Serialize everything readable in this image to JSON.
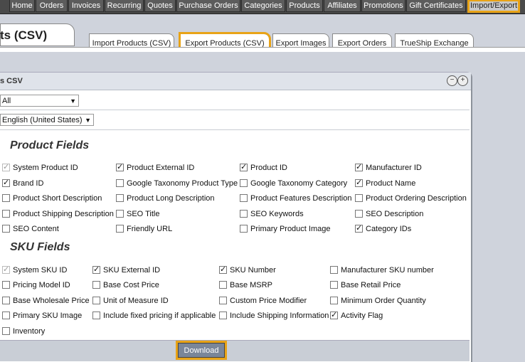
{
  "topnav": {
    "items": [
      "Home",
      "Orders",
      "Invoices",
      "Recurring",
      "Quotes",
      "Purchase Orders",
      "Categories",
      "Products",
      "Affiliates",
      "Promotions",
      "Gift Certificates",
      "Import/Export"
    ]
  },
  "page": {
    "title_fragment": "ts (CSV)"
  },
  "subtabs": [
    "Import Products (CSV)",
    "Export Products (CSV)",
    "Export Images",
    "Export Orders",
    "TrueShip Exchange"
  ],
  "panel": {
    "title_fragment": "s CSV",
    "select_scope": "All",
    "select_language": "English (United States)"
  },
  "product_fields": {
    "title": "Product Fields",
    "items": [
      {
        "label": "System Product ID",
        "checked": true,
        "disabled": true
      },
      {
        "label": "Product External ID",
        "checked": true,
        "disabled": false
      },
      {
        "label": "Product ID",
        "checked": true,
        "disabled": false
      },
      {
        "label": "Manufacturer ID",
        "checked": true,
        "disabled": false
      },
      {
        "label": "Brand ID",
        "checked": true,
        "disabled": false
      },
      {
        "label": "Google Taxonomy Product Type",
        "checked": false,
        "disabled": false
      },
      {
        "label": "Google Taxonomy Category",
        "checked": false,
        "disabled": false
      },
      {
        "label": "Product Name",
        "checked": true,
        "disabled": false
      },
      {
        "label": "Product Short Description",
        "checked": false,
        "disabled": false
      },
      {
        "label": "Product Long Description",
        "checked": false,
        "disabled": false
      },
      {
        "label": "Product Features Description",
        "checked": false,
        "disabled": false
      },
      {
        "label": "Product Ordering Description",
        "checked": false,
        "disabled": false
      },
      {
        "label": "Product Shipping Description",
        "checked": false,
        "disabled": false
      },
      {
        "label": "SEO Title",
        "checked": false,
        "disabled": false
      },
      {
        "label": "SEO Keywords",
        "checked": false,
        "disabled": false
      },
      {
        "label": "SEO Description",
        "checked": false,
        "disabled": false
      },
      {
        "label": "SEO Content",
        "checked": false,
        "disabled": false
      },
      {
        "label": "Friendly URL",
        "checked": false,
        "disabled": false
      },
      {
        "label": "Primary Product Image",
        "checked": false,
        "disabled": false
      },
      {
        "label": "Category IDs",
        "checked": true,
        "disabled": false
      }
    ]
  },
  "sku_fields": {
    "title": "SKU Fields",
    "items": [
      {
        "label": "System SKU ID",
        "checked": true,
        "disabled": true
      },
      {
        "label": "SKU External ID",
        "checked": true,
        "disabled": false
      },
      {
        "label": "SKU Number",
        "checked": true,
        "disabled": false
      },
      {
        "label": "Manufacturer SKU number",
        "checked": false,
        "disabled": false
      },
      {
        "label": "Pricing Model ID",
        "checked": false,
        "disabled": false
      },
      {
        "label": "Base Cost Price",
        "checked": false,
        "disabled": false
      },
      {
        "label": "Base MSRP",
        "checked": false,
        "disabled": false
      },
      {
        "label": "Base Retail Price",
        "checked": false,
        "disabled": false
      },
      {
        "label": "Base Wholesale Price",
        "checked": false,
        "disabled": false
      },
      {
        "label": "Unit of Measure ID",
        "checked": false,
        "disabled": false
      },
      {
        "label": "Custom Price Modifier",
        "checked": false,
        "disabled": false
      },
      {
        "label": "Minimum Order Quantity",
        "checked": false,
        "disabled": false
      },
      {
        "label": "Primary SKU Image",
        "checked": false,
        "disabled": false
      },
      {
        "label": "Include fixed pricing if applicable",
        "checked": false,
        "disabled": false
      },
      {
        "label": "Include Shipping Information",
        "checked": false,
        "disabled": false
      },
      {
        "label": "Activity Flag",
        "checked": true,
        "disabled": false
      },
      {
        "label": "Inventory",
        "checked": false,
        "disabled": false
      }
    ]
  },
  "footer": {
    "download_label": "Download"
  }
}
